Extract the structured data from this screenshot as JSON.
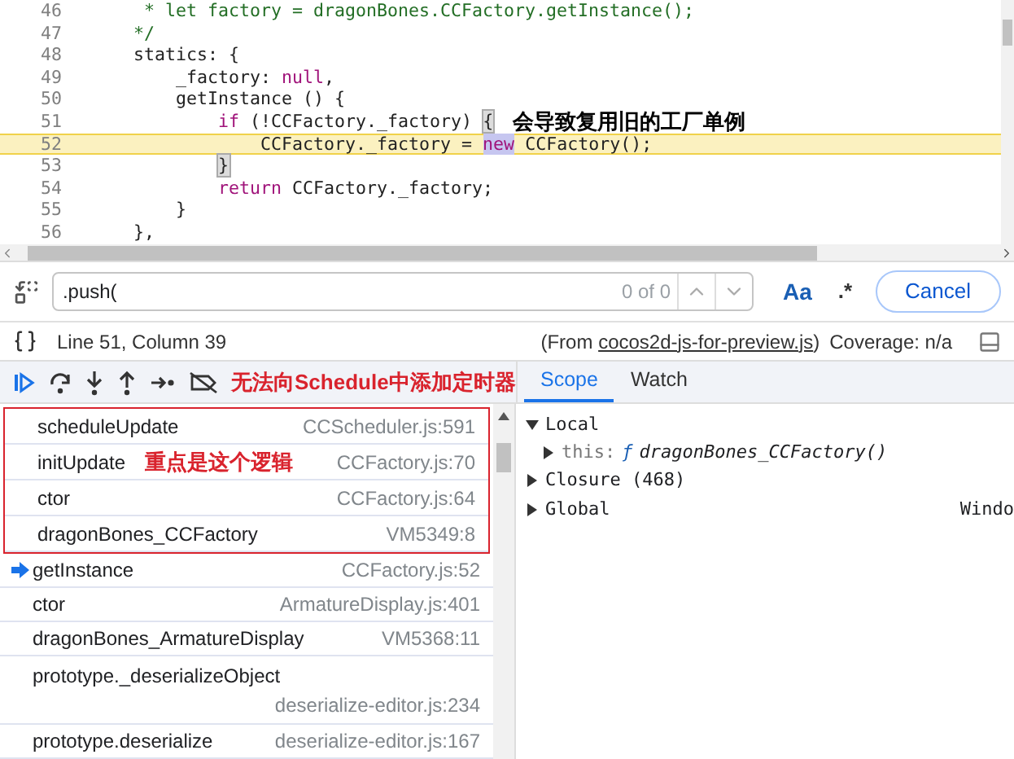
{
  "editor": {
    "lines": [
      {
        "number": "46",
        "highlighted": false,
        "segments": [
          {
            "kind": "comment",
            "text": "     * let factory = dragonBones.CCFactory.getInstance();"
          }
        ]
      },
      {
        "number": "47",
        "highlighted": false,
        "segments": [
          {
            "kind": "comment",
            "text": "    */"
          }
        ]
      },
      {
        "number": "48",
        "highlighted": false,
        "segments": [
          {
            "kind": "plain",
            "text": "    statics: {"
          }
        ]
      },
      {
        "number": "49",
        "highlighted": false,
        "segments": [
          {
            "kind": "plain",
            "text": "        _factory: "
          },
          {
            "kind": "keyword",
            "text": "null"
          },
          {
            "kind": "plain",
            "text": ","
          }
        ]
      },
      {
        "number": "50",
        "highlighted": false,
        "segments": [
          {
            "kind": "plain",
            "text": "        getInstance () {"
          }
        ]
      },
      {
        "number": "51",
        "highlighted": false,
        "segments": [
          {
            "kind": "keyword",
            "text": "            if"
          },
          {
            "kind": "plain",
            "text": " (!CCFactory._factory) "
          },
          {
            "kind": "bracket",
            "text": "{"
          }
        ],
        "note": "会导致复用旧的工厂单例"
      },
      {
        "number": "52",
        "highlighted": true,
        "segments": [
          {
            "kind": "plain",
            "text": "                CCFactory._factory = "
          },
          {
            "kind": "match",
            "text": "new"
          },
          {
            "kind": "plain",
            "text": " CCFactory();"
          }
        ]
      },
      {
        "number": "53",
        "highlighted": false,
        "segments": [
          {
            "kind": "bracket",
            "text": "            }"
          }
        ]
      },
      {
        "number": "54",
        "highlighted": false,
        "segments": [
          {
            "kind": "keyword",
            "text": "            return"
          },
          {
            "kind": "plain",
            "text": " CCFactory._factory;"
          }
        ]
      },
      {
        "number": "55",
        "highlighted": false,
        "segments": [
          {
            "kind": "plain",
            "text": "        }"
          }
        ]
      },
      {
        "number": "56",
        "highlighted": false,
        "segments": [
          {
            "kind": "plain",
            "text": "    },"
          }
        ]
      }
    ]
  },
  "search": {
    "value": ".push(",
    "count": "0 of 0",
    "match_case": "Aa",
    "regex": ".*",
    "cancel": "Cancel"
  },
  "status": {
    "position": "Line 51, Column 39",
    "source_prefix": "(From",
    "source_file": "cocos2d-js-for-preview.js",
    "source_suffix": ")",
    "coverage": "Coverage: n/a"
  },
  "toolbar_note": "无法向Schedule中添加定时器",
  "call_stack": [
    {
      "name": "scheduleUpdate",
      "location": "CCScheduler.js:591",
      "current": false,
      "boxed": true
    },
    {
      "name": "initUpdate",
      "location": "CCFactory.js:70",
      "current": false,
      "boxed": true,
      "note": "重点是这个逻辑"
    },
    {
      "name": "ctor",
      "location": "CCFactory.js:64",
      "current": false,
      "boxed": true
    },
    {
      "name": "dragonBones_CCFactory",
      "location": "VM5349:8",
      "current": false,
      "boxed": true
    },
    {
      "name": "getInstance",
      "location": "CCFactory.js:52",
      "current": true,
      "boxed": false
    },
    {
      "name": "ctor",
      "location": "ArmatureDisplay.js:401",
      "current": false,
      "boxed": false
    },
    {
      "name": "dragonBones_ArmatureDisplay",
      "location": "VM5368:11",
      "current": false,
      "boxed": false
    },
    {
      "name": "prototype._deserializeObject",
      "location": "deserialize-editor.js:234",
      "current": false,
      "boxed": false,
      "wrap": true
    },
    {
      "name": "prototype.deserialize",
      "location": "deserialize-editor.js:167",
      "current": false,
      "boxed": false
    }
  ],
  "tabs": [
    {
      "label": "Scope",
      "selected": true
    },
    {
      "label": "Watch",
      "selected": false
    }
  ],
  "scope": [
    {
      "label": "Local",
      "expanded": true,
      "children": [
        {
          "key": "this:",
          "type_mark": "ƒ",
          "value": "dragonBones_CCFactory()",
          "expanded": false
        }
      ]
    },
    {
      "label": "Closure (468)",
      "expanded": false
    },
    {
      "label": "Global",
      "expanded": false,
      "value": "Windo"
    }
  ]
}
